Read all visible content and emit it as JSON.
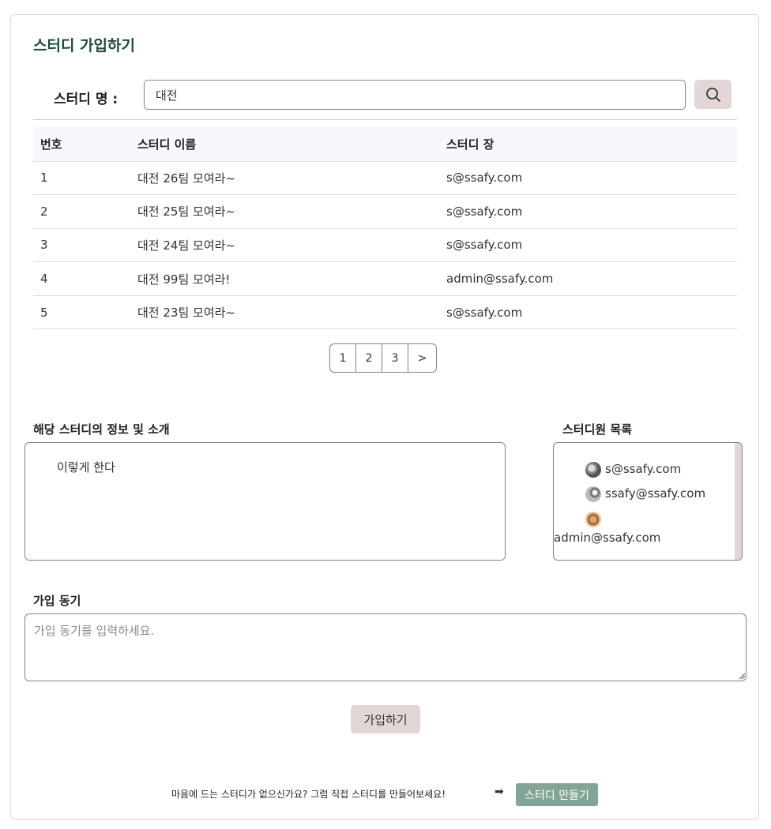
{
  "page_title": "스터디 가입하기",
  "search": {
    "label": "스터디 명 :",
    "value": "대전",
    "icon": "search-icon"
  },
  "table": {
    "headers": [
      "번호",
      "스터디 이름",
      "스터디 장"
    ],
    "rows": [
      {
        "no": "1",
        "name": "대전 26팀 모여라~",
        "leader": "s@ssafy.com"
      },
      {
        "no": "2",
        "name": "대전 25팀 모여라~",
        "leader": "s@ssafy.com"
      },
      {
        "no": "3",
        "name": "대전 24팀 모여라~",
        "leader": "s@ssafy.com"
      },
      {
        "no": "4",
        "name": "대전 99팀 모여라!",
        "leader": "admin@ssafy.com"
      },
      {
        "no": "5",
        "name": "대전 23팀 모여라~",
        "leader": "s@ssafy.com"
      }
    ]
  },
  "pagination": {
    "pages": [
      "1",
      "2",
      "3"
    ],
    "next": ">"
  },
  "intro": {
    "heading": "해당 스터디의 정보 및 소개",
    "text": "이렇게 한다"
  },
  "members": {
    "heading": "스터디원 목록",
    "list": [
      "s@ssafy.com",
      "ssafy@ssafy.com",
      "admin@ssafy.com"
    ]
  },
  "motive": {
    "heading": "가입 동기",
    "placeholder": "가입 동기를 입력하세요."
  },
  "join_button": "가입하기",
  "footer": {
    "text": "마음에 드는 스터디가 없으신가요? 그럼 직접 스터디를 만들어보세요!",
    "arrow": "➡",
    "create_button": "스터디 만들기"
  },
  "colors": {
    "title": "#1f4a3a",
    "button_bg": "#e2d6d6",
    "create_button_bg": "#84a595",
    "border": "#8a7f84"
  }
}
